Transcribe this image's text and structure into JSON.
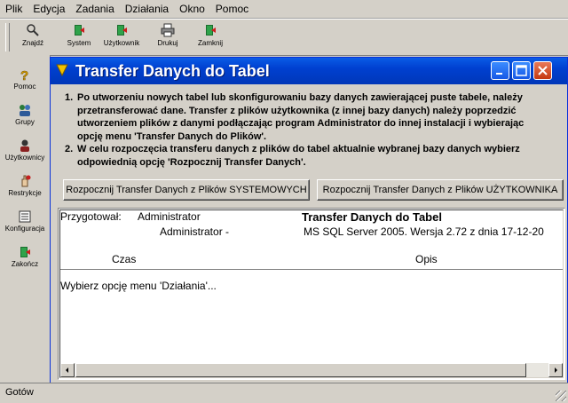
{
  "menubar": {
    "items": [
      {
        "label": "Plik"
      },
      {
        "label": "Edycja"
      },
      {
        "label": "Zadania"
      },
      {
        "label": "Działania"
      },
      {
        "label": "Okno"
      },
      {
        "label": "Pomoc"
      }
    ]
  },
  "toolbar": {
    "buttons": [
      {
        "label": "Znajdź",
        "icon": "search-icon"
      },
      {
        "label": "System",
        "icon": "system-icon"
      },
      {
        "label": "Użytkownik",
        "icon": "user-icon"
      },
      {
        "label": "Drukuj",
        "icon": "printer-icon"
      },
      {
        "label": "Zamknij",
        "icon": "exit-icon"
      }
    ]
  },
  "sidebar": {
    "buttons": [
      {
        "label": "Pomoc",
        "icon": "help-icon"
      },
      {
        "label": "Grupy",
        "icon": "groups-icon"
      },
      {
        "label": "Użytkownicy",
        "icon": "users-icon"
      },
      {
        "label": "Restrykcje",
        "icon": "restrictions-icon"
      },
      {
        "label": "Konfiguracja",
        "icon": "config-icon"
      },
      {
        "label": "Zakończ",
        "icon": "exit-icon"
      }
    ]
  },
  "window": {
    "title": "Transfer Danych do Tabel",
    "instructions": [
      {
        "num": "1.",
        "lines": [
          "Po utworzeniu nowych tabel lub skonfigurowaniu bazy danych zawierającej puste tabele, należy",
          "przetransferować dane. Transfer z plików użytkownika (z innej bazy danych) należy poprzedzić",
          "utworzeniem plików z danymi podłączając program Administrator do innej instalacji i wybierając",
          "opcję menu 'Transfer Danych do Plików'."
        ]
      },
      {
        "num": "2.",
        "lines": [
          "W celu rozpoczęcia transferu danych z plików do tabel aktualnie wybranej bazy danych wybierz",
          "odpowiednią opcję 'Rozpocznij Transfer Danych'."
        ]
      }
    ],
    "btn_system": "Rozpocznij Transfer Danych z Plików SYSTEMOWYCH",
    "btn_user": "Rozpocznij Transfer Danych z Plików UŻYTKOWNIKA",
    "log": {
      "prepared_label": "Przygotował:",
      "prepared_value": "Administrator",
      "prepared_value2": "Administrator -",
      "report_title": "Transfer Danych do Tabel",
      "server_info": "MS SQL Server 2005. Wersja 2.72 z dnia 17-12-20",
      "col_time": "Czas",
      "col_desc": "Opis",
      "message": "Wybierz opcję menu 'Działania'..."
    }
  },
  "statusbar": {
    "text": "Gotów"
  }
}
